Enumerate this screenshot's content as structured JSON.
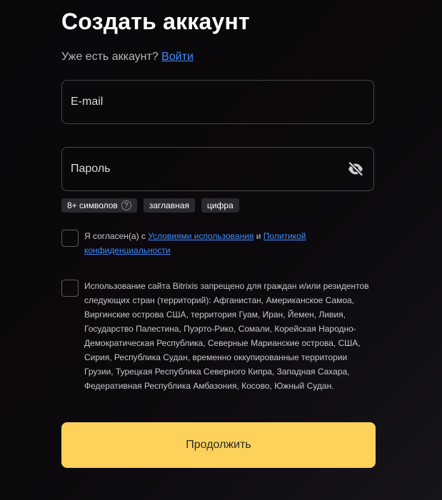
{
  "header": {
    "title": "Создать аккаунт"
  },
  "login_prompt": {
    "text": "Уже есть аккаунт?",
    "link_label": "Войти"
  },
  "email": {
    "placeholder": "E-mail",
    "value": ""
  },
  "password": {
    "placeholder": "Пароль",
    "value": "",
    "visibility_icon": "eye-off-icon"
  },
  "password_requirements": [
    {
      "label": "8+ символов",
      "help_icon": "?"
    },
    {
      "label": "заглавная"
    },
    {
      "label": "цифра"
    }
  ],
  "terms": {
    "checked": false,
    "prefix": "Я согласен(а) с",
    "terms_link": "Условиями использования",
    "conjunction": "и",
    "privacy_link_part1": "Политикой",
    "privacy_link_part2": "конфиденциальности"
  },
  "restriction": {
    "checked": false,
    "text": "Использование сайта Bitrixis запрещено для граждан и/или резидентов следующих стран (территорий): Афганистан, Американское Самоа, Виргинские острова США, территория Гуам, Иран, Йемен, Ливия, Государство Палестина, Пуэрто-Рико, Сомали, Корейская Народно-Демократическая Республика, Северные Марианские острова, США, Сирия, Республика Судан, временно оккупированные территории Грузии, Турецкая Республика Северного Кипра, Западная Сахара, Федеративная Республика Амбазония, Косово, Южный Судан."
  },
  "submit": {
    "label": "Продолжить"
  },
  "colors": {
    "accent_button": "#fdd25a",
    "link": "#3d8dff",
    "background": "#0b080c",
    "field_border": "#46464b"
  }
}
